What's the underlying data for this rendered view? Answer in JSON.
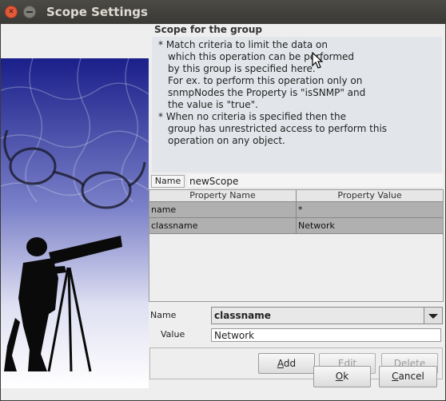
{
  "window": {
    "title": "Scope Settings"
  },
  "scope": {
    "group_title": "Scope for the group",
    "info_lines": [
      "*  Match criteria to limit the data on",
      "which this operation can be performed",
      "by this group is specified here.",
      "For ex. to perform this operation only on",
      "snmpNodes the Property is \"isSNMP\" and",
      "the value is \"true\".",
      "*  When no criteria is specified then the",
      "group has unrestricted access to perform this",
      "operation on any object."
    ]
  },
  "name_field": {
    "label": "Name",
    "value": "newScope"
  },
  "table": {
    "headers": [
      "Property Name",
      "Property Value"
    ],
    "rows": [
      {
        "name": "name",
        "value": "*"
      },
      {
        "name": "classname",
        "value": "Network"
      }
    ]
  },
  "editor": {
    "name_label": "Name",
    "name_selected": "classname",
    "value_label": "Value",
    "value": "Network"
  },
  "buttons": {
    "add": {
      "first": "A",
      "rest": "dd"
    },
    "edit": {
      "first": "E",
      "rest": "dit"
    },
    "delete": {
      "first": "D",
      "rest": "elete"
    },
    "ok": {
      "first": "O",
      "rest": "k"
    },
    "cancel": {
      "first": "C",
      "rest": "ancel"
    }
  },
  "colors": {
    "titlebar": "#3c3b37",
    "close": "#e4593a",
    "panel": "#eeeeee",
    "info_bg": "#e2e6ea",
    "row_bg": "#b0b0b0"
  }
}
